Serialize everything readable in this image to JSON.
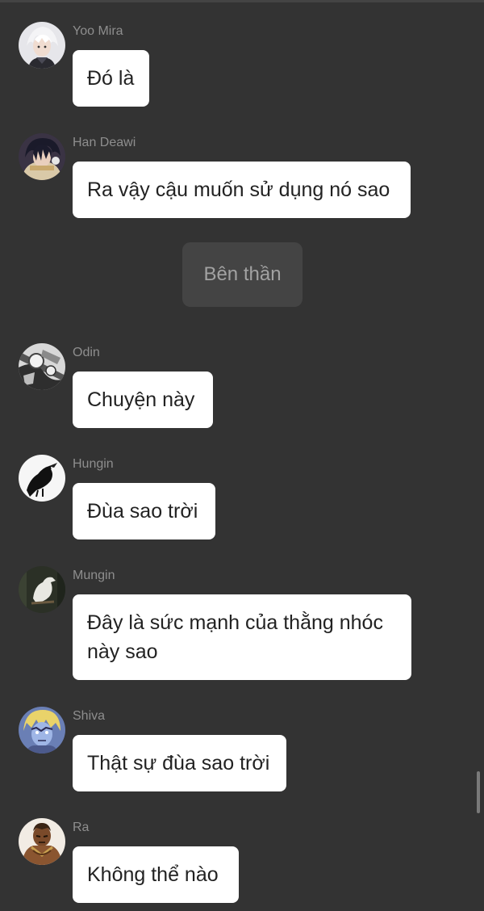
{
  "chat": {
    "messages": [
      {
        "sender": "Yoo Mira",
        "text": "Đó là",
        "avatar_icon": "white-haired-character-avatar-icon"
      },
      {
        "sender": "Han Deawi",
        "text": "Ra vậy cậu muốn sử dụng nó sao",
        "avatar_icon": "dark-haired-character-avatar-icon"
      }
    ],
    "narration": "Bên thần",
    "messages2": [
      {
        "sender": "Odin",
        "text": "Chuyện này",
        "avatar_icon": "manga-panel-avatar-icon"
      },
      {
        "sender": "Hungin",
        "text": "Đùa sao trời",
        "avatar_icon": "black-crow-avatar-icon"
      },
      {
        "sender": "Mungin",
        "text": "Đây là sức mạnh của thằng nhóc này sao",
        "avatar_icon": "white-raven-avatar-icon"
      },
      {
        "sender": "Shiva",
        "text": "Thật sự đùa sao trời",
        "avatar_icon": "blonde-character-avatar-icon"
      },
      {
        "sender": "Ra",
        "text": "Không thể nào",
        "avatar_icon": "warrior-character-avatar-icon"
      }
    ]
  },
  "colors": {
    "background": "#333333",
    "bubble": "#ffffff",
    "narration_bubble": "#444444",
    "sender_text": "#8e8e8e"
  }
}
